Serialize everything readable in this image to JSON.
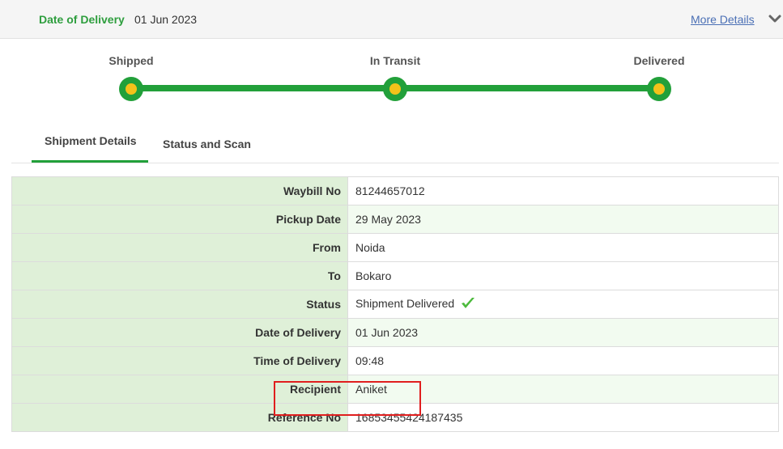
{
  "header": {
    "date_label": "Date of Delivery",
    "date_value": "01 Jun 2023",
    "more_details": "More Details"
  },
  "tracker": {
    "steps": [
      "Shipped",
      "In Transit",
      "Delivered"
    ],
    "progress_percent": 100
  },
  "tabs": [
    {
      "label": "Shipment Details",
      "active": true
    },
    {
      "label": "Status and Scan",
      "active": false
    }
  ],
  "details": [
    {
      "key": "Waybill No",
      "value": "81244657012"
    },
    {
      "key": "Pickup Date",
      "value": "29 May 2023"
    },
    {
      "key": "From",
      "value": "Noida"
    },
    {
      "key": "To",
      "value": "Bokaro"
    },
    {
      "key": "Status",
      "value": "Shipment Delivered"
    },
    {
      "key": "Date of Delivery",
      "value": "01 Jun 2023"
    },
    {
      "key": "Time of Delivery",
      "value": "09:48"
    },
    {
      "key": "Recipient",
      "value": "Aniket"
    },
    {
      "key": "Reference No",
      "value": "16853455424187435"
    }
  ],
  "colors": {
    "accent_green": "#22a03a",
    "node_center": "#f4c21a",
    "label_bg": "#dff0d8",
    "highlight": "#e01e1e",
    "link": "#4a6fb5"
  },
  "icons": {
    "header_toggle": "chevron-down-icon",
    "status_indicator": "check-icon"
  }
}
